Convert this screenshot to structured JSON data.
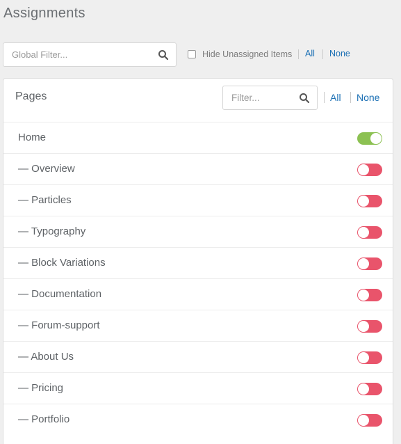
{
  "header": {
    "title": "Assignments"
  },
  "global_filter": {
    "placeholder": "Global Filter...",
    "value": ""
  },
  "hide_unassigned": {
    "label": "Hide Unassigned Items",
    "checked": false
  },
  "top_links": {
    "all": "All",
    "none": "None"
  },
  "panel": {
    "title": "Pages",
    "filter_placeholder": "Filter...",
    "all": "All",
    "none": "None",
    "items": [
      {
        "label": "Home",
        "enabled": true
      },
      {
        "label": "— Overview",
        "enabled": false
      },
      {
        "label": "— Particles",
        "enabled": false
      },
      {
        "label": "— Typography",
        "enabled": false
      },
      {
        "label": "— Block Variations",
        "enabled": false
      },
      {
        "label": "— Documentation",
        "enabled": false
      },
      {
        "label": "— Forum-support",
        "enabled": false
      },
      {
        "label": "— About Us",
        "enabled": false
      },
      {
        "label": "— Pricing",
        "enabled": false
      },
      {
        "label": "— Portfolio",
        "enabled": false
      }
    ]
  },
  "colors": {
    "on": "#8cc152",
    "off": "#e9546b",
    "link": "#1a6fb4"
  }
}
